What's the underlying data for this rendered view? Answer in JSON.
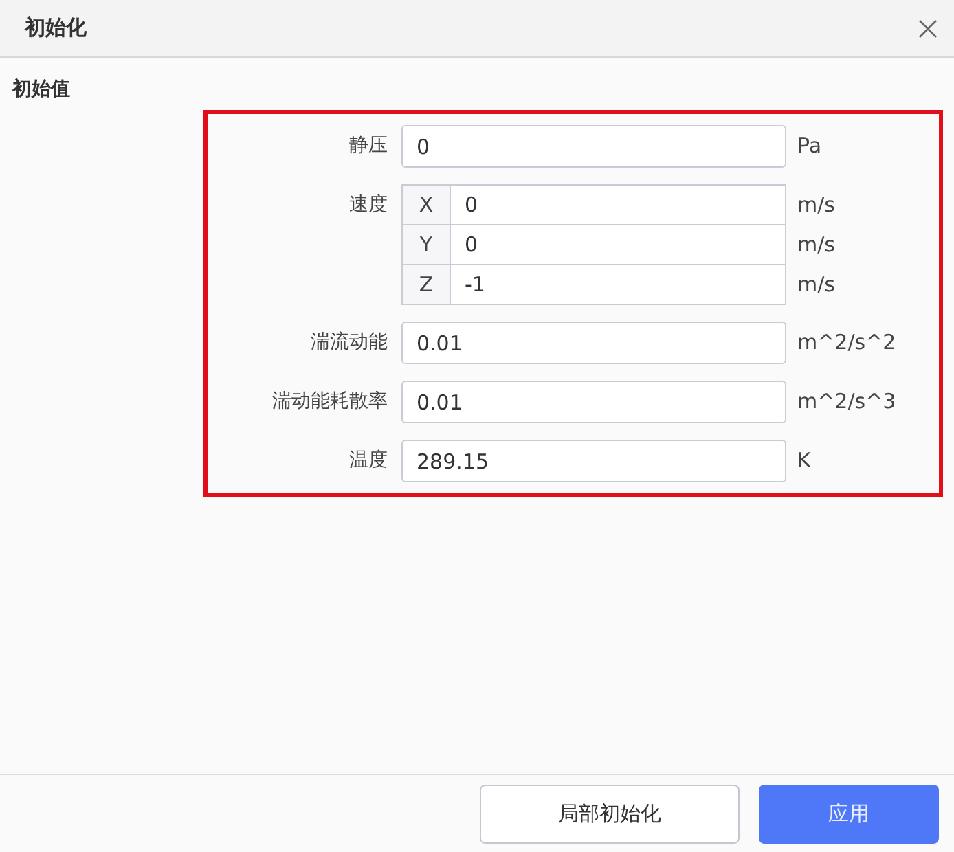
{
  "window": {
    "title": "初始化"
  },
  "section": {
    "title": "初始值"
  },
  "fields": [
    {
      "kind": "scalar",
      "label": "静压",
      "value": "0",
      "unit": "Pa"
    },
    {
      "kind": "vector",
      "label": "速度",
      "components": [
        {
          "axis": "X",
          "value": "0",
          "unit": "m/s"
        },
        {
          "axis": "Y",
          "value": "0",
          "unit": "m/s"
        },
        {
          "axis": "Z",
          "value": "-1",
          "unit": "m/s"
        }
      ]
    },
    {
      "kind": "scalar",
      "label": "湍流动能",
      "value": "0.01",
      "unit": "m^2/s^2"
    },
    {
      "kind": "scalar",
      "label": "湍动能耗散率",
      "value": "0.01",
      "unit": "m^2/s^3"
    },
    {
      "kind": "scalar",
      "label": "温度",
      "value": "289.15",
      "unit": "K"
    }
  ],
  "buttons": [
    {
      "kind": "secondary",
      "label": "局部初始化"
    },
    {
      "kind": "primary",
      "label": "应用"
    }
  ]
}
